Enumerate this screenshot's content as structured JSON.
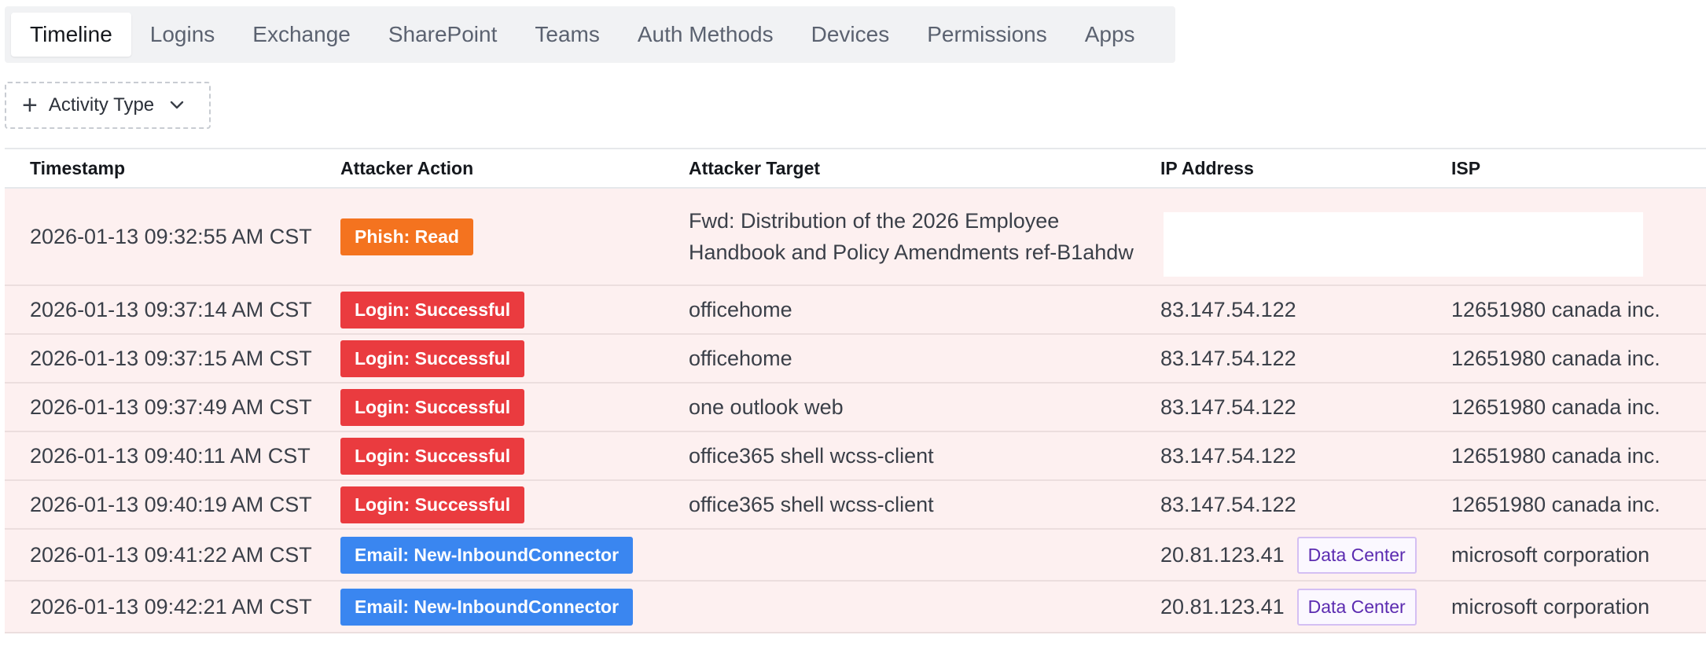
{
  "tabs": [
    {
      "label": "Timeline",
      "active": true
    },
    {
      "label": "Logins"
    },
    {
      "label": "Exchange"
    },
    {
      "label": "SharePoint"
    },
    {
      "label": "Teams"
    },
    {
      "label": "Auth Methods"
    },
    {
      "label": "Devices"
    },
    {
      "label": "Permissions"
    },
    {
      "label": "Apps"
    }
  ],
  "filter": {
    "label": "Activity Type"
  },
  "table": {
    "headers": {
      "timestamp": "Timestamp",
      "action": "Attacker Action",
      "target": "Attacker Target",
      "ip": "IP Address",
      "isp": "ISP"
    },
    "rows": [
      {
        "timestamp": "2026-01-13 09:32:55 AM CST",
        "action": "Phish: Read",
        "action_color": "#f4731f",
        "target": "Fwd: Distribution of the 2026 Employee Handbook and Policy Amendments ref-B1ahdw",
        "ip": "",
        "tag": "",
        "isp": ""
      },
      {
        "timestamp": "2026-01-13 09:37:14 AM CST",
        "action": "Login: Successful",
        "action_color": "#ea3b3f",
        "target": "officehome",
        "ip": "83.147.54.122",
        "tag": "",
        "isp": "12651980 canada inc."
      },
      {
        "timestamp": "2026-01-13 09:37:15 AM CST",
        "action": "Login: Successful",
        "action_color": "#ea3b3f",
        "target": "officehome",
        "ip": "83.147.54.122",
        "tag": "",
        "isp": "12651980 canada inc."
      },
      {
        "timestamp": "2026-01-13 09:37:49 AM CST",
        "action": "Login: Successful",
        "action_color": "#ea3b3f",
        "target": "one outlook web",
        "ip": "83.147.54.122",
        "tag": "",
        "isp": "12651980 canada inc."
      },
      {
        "timestamp": "2026-01-13 09:40:11 AM CST",
        "action": "Login: Successful",
        "action_color": "#ea3b3f",
        "target": "office365 shell wcss-client",
        "ip": "83.147.54.122",
        "tag": "",
        "isp": "12651980 canada inc."
      },
      {
        "timestamp": "2026-01-13 09:40:19 AM CST",
        "action": "Login: Successful",
        "action_color": "#ea3b3f",
        "target": "office365 shell wcss-client",
        "ip": "83.147.54.122",
        "tag": "",
        "isp": "12651980 canada inc."
      },
      {
        "timestamp": "2026-01-13 09:41:22 AM CST",
        "action": "Email: New-InboundConnector",
        "action_color": "#3a86f0",
        "target": "",
        "ip": "20.81.123.41",
        "tag": "Data Center",
        "isp": "microsoft corporation"
      },
      {
        "timestamp": "2026-01-13 09:42:21 AM CST",
        "action": "Email: New-InboundConnector",
        "action_color": "#3a86f0",
        "target": "",
        "ip": "20.81.123.41",
        "tag": "Data Center",
        "isp": "microsoft corporation"
      }
    ]
  }
}
